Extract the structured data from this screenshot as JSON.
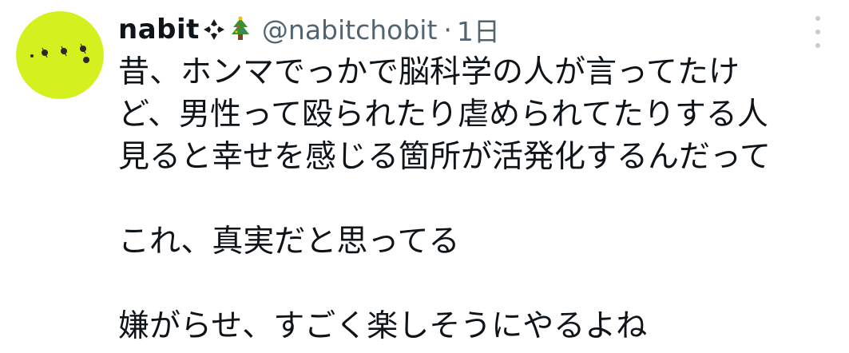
{
  "tweet": {
    "display_name": "nabit",
    "name_emoji": [
      "diamond-sparkle-icon",
      "christmas-tree-icon"
    ],
    "handle": "@nabitchobit",
    "separator": "·",
    "time": "1日",
    "lines": [
      "昔、ホンマでっかで脳科学の人が言ってたけ",
      "ど、男性って殴られたり虐められてたりする人",
      "見ると幸せを感じる箇所が活発化するんだって",
      "",
      "これ、真実だと思ってる",
      "",
      "嫌がらせ、すごく楽しそうにやるよね"
    ]
  },
  "colors": {
    "text": "#0f1419",
    "secondary": "#536471",
    "avatar_bg": "#d4f01f",
    "avatar_dot": "#2a2a2a",
    "more_dots": "#c8ccd0"
  }
}
